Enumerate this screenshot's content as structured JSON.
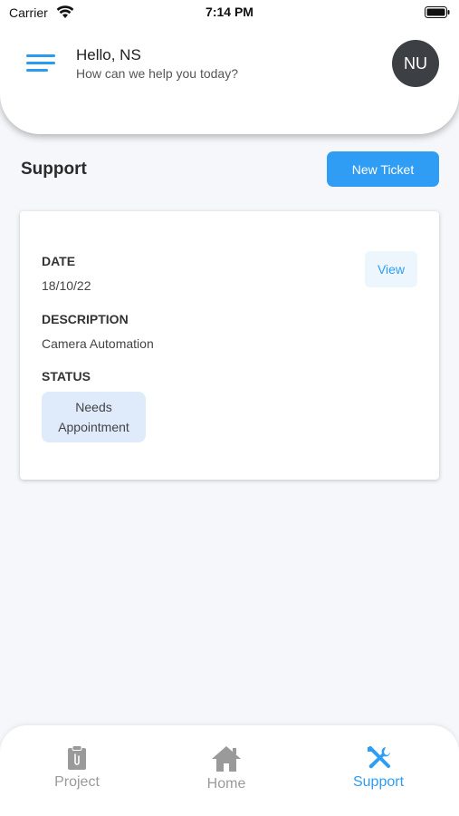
{
  "status_bar": {
    "carrier": "Carrier",
    "time": "7:14 PM"
  },
  "header": {
    "greeting": "Hello, NS",
    "subgreeting": "How can we help you today?",
    "avatar_initials": "NU"
  },
  "support": {
    "title": "Support",
    "new_ticket_label": "New Ticket"
  },
  "ticket": {
    "date_label": "DATE",
    "date_value": "18/10/22",
    "description_label": "DESCRIPTION",
    "description_value": "Camera Automation",
    "status_label": "STATUS",
    "status_value": "Needs Appointment",
    "view_label": "View"
  },
  "nav": {
    "project": "Project",
    "home": "Home",
    "support": "Support"
  },
  "colors": {
    "accent": "#2f9df3",
    "inactive": "#9a9a9a",
    "avatar_bg": "#3c3f44",
    "badge_bg": "#dfeafb"
  }
}
